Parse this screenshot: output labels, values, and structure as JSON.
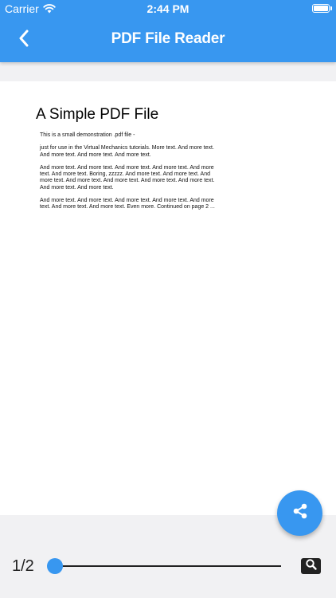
{
  "status_bar": {
    "carrier": "Carrier",
    "time": "2:44 PM",
    "battery_level": 1.0
  },
  "nav": {
    "title": "PDF File Reader",
    "back_icon": "chevron-left-icon"
  },
  "document": {
    "title": "A Simple PDF File",
    "paragraphs": [
      "This is a small demonstration .pdf file -",
      "just for use in the Virtual Mechanics tutorials. More text. And more text. And more text. And more text. And more text.",
      "And more text. And more text. And more text. And more text. And more text. And more text. Boring, zzzzz. And more text. And more text. And more text. And more text. And more text. And more text. And more text. And more text. And more text.",
      "And more text. And more text. And more text. And more text. And more text. And more text. And more text. Even more. Continued on page 2 ..."
    ]
  },
  "controls": {
    "page_indicator": "1/2",
    "current_page": 1,
    "total_pages": 2,
    "share_icon": "share-icon",
    "search_icon": "search-icon"
  },
  "colors": {
    "accent": "#3897f0",
    "background": "#f1f1f3",
    "page": "#ffffff"
  }
}
